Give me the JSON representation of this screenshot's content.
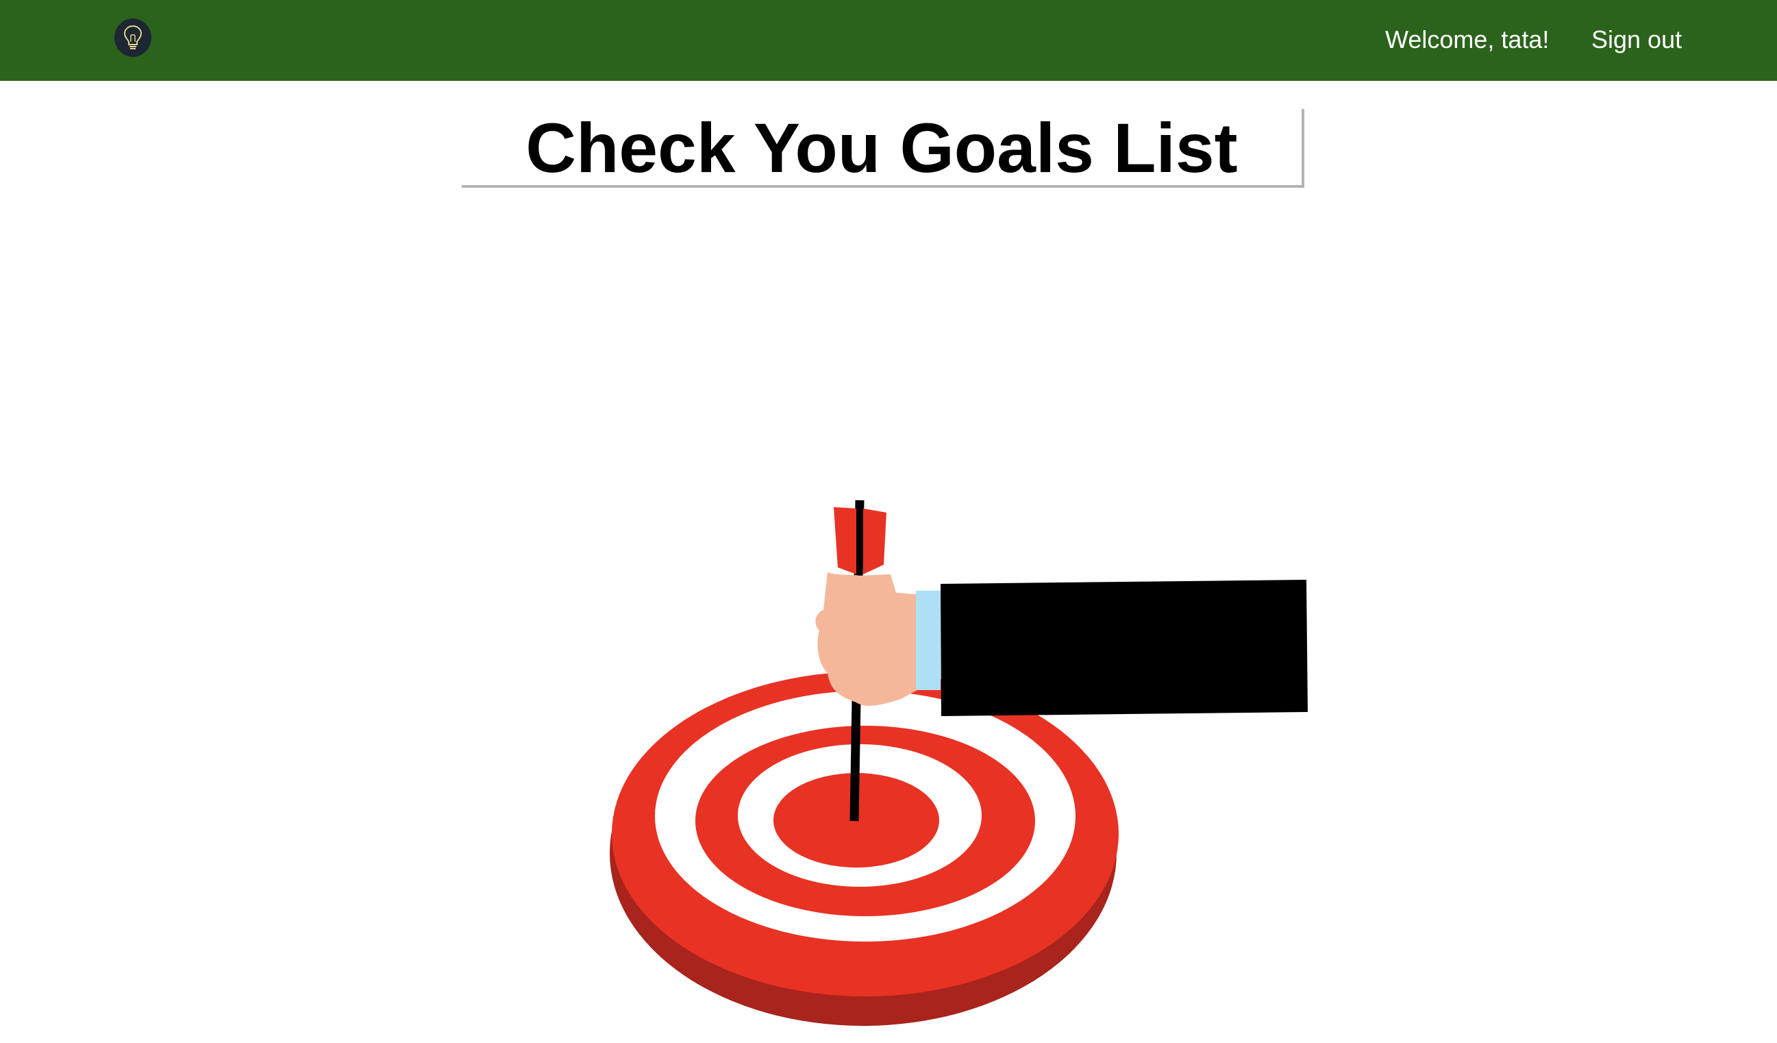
{
  "navbar": {
    "logo_icon": "lightbulb-icon",
    "welcome_text": "Welcome, tata!",
    "signout_label": "Sign out",
    "background_color": "#2c631c"
  },
  "main": {
    "title": "Check You Goals List",
    "illustration": "target-dart-hand-illustration"
  },
  "colors": {
    "target_red": "#e83224",
    "target_dark_red": "#a8241c",
    "sleeve": "#000000",
    "cuff": "#aedff7",
    "skin": "#f4b79a"
  }
}
